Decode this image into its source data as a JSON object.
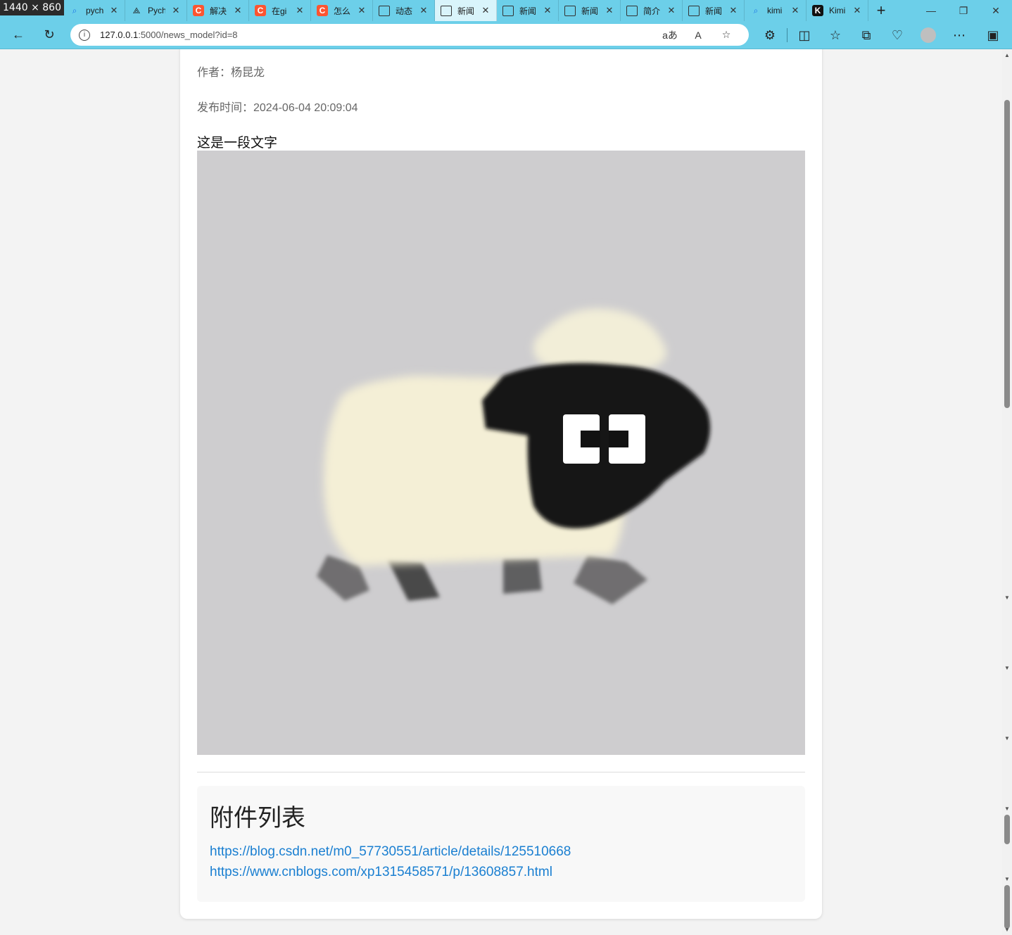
{
  "overlay_badge": "1440 × 860",
  "tabs": [
    {
      "icon": "search-icon",
      "title": "pych"
    },
    {
      "icon": "pycharm-icon",
      "title": "Pych"
    },
    {
      "icon": "csdn-icon",
      "title": "解决"
    },
    {
      "icon": "csdn-icon",
      "title": "在gi"
    },
    {
      "icon": "csdn-icon",
      "title": "怎么"
    },
    {
      "icon": "page-icon",
      "title": "动态"
    },
    {
      "icon": "page-icon",
      "title": "新闻",
      "active": true
    },
    {
      "icon": "page-icon",
      "title": "新闻"
    },
    {
      "icon": "page-icon",
      "title": "新闻"
    },
    {
      "icon": "page-icon",
      "title": "简介"
    },
    {
      "icon": "page-icon",
      "title": "新闻"
    },
    {
      "icon": "search-icon",
      "title": "kimi"
    },
    {
      "icon": "kimi-icon",
      "title": "Kimi"
    }
  ],
  "address": {
    "host": "127.0.0.1",
    "rest": ":5000/news_model?id=8"
  },
  "article": {
    "author_label": "作者：杨昆龙",
    "publish_label": "发布时间：2024-06-04 20:09:04",
    "body": "这是一段文字"
  },
  "attachments": {
    "heading": "附件列表",
    "links": [
      "https://blog.csdn.net/m0_57730551/article/details/125510668",
      "https://www.cnblogs.com/xp1315458571/p/13608857.html"
    ]
  },
  "colors": {
    "browser_frame": "#6ccfe9",
    "link": "#1a7fd1",
    "image_bg": "#cecdcf"
  }
}
